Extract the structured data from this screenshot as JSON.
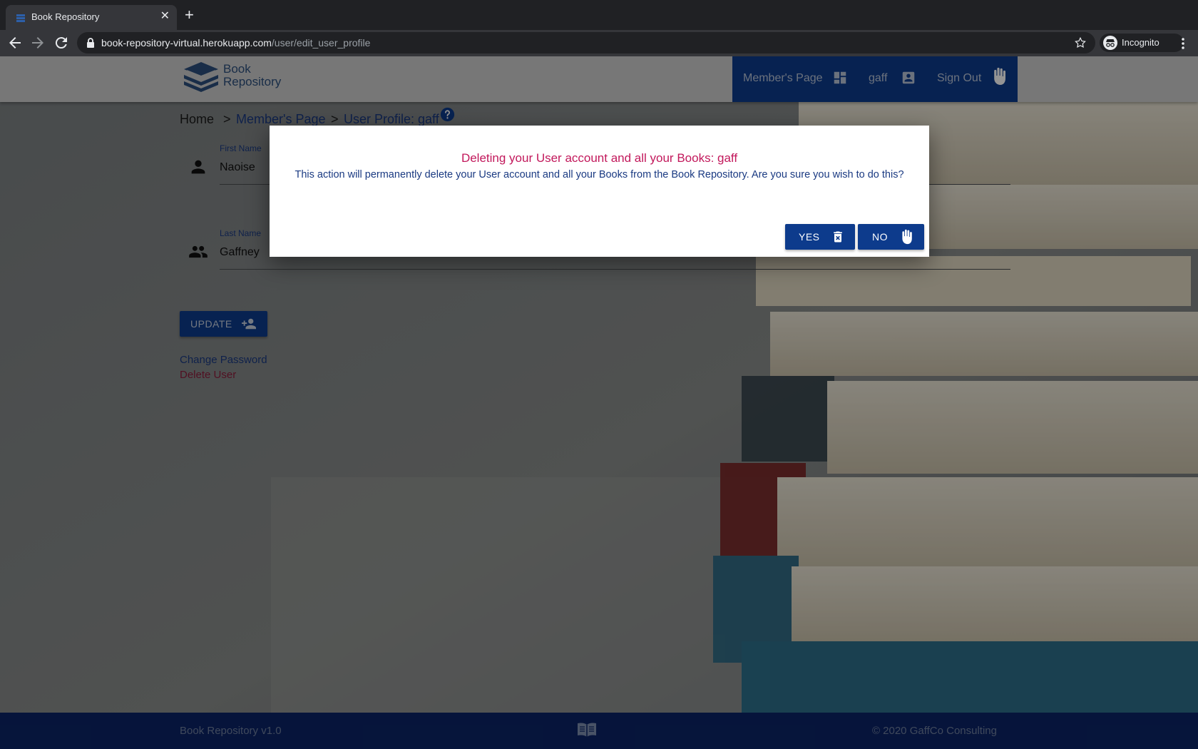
{
  "browser": {
    "tab_title": "Book Repository",
    "tab_close": "✕",
    "new_tab": "+",
    "url_host": "book-repository-virtual.herokuapp.com",
    "url_path": "/user/edit_user_profile",
    "profile_label": "Incognito"
  },
  "navbar": {
    "logo_line1": "Book",
    "logo_line2": "Repository",
    "members_page": "Member's Page",
    "username": "gaff",
    "sign_out": "Sign Out"
  },
  "breadcrumb": {
    "home": "Home",
    "separator": ">",
    "members_page": "Member's Page",
    "current": "User Profile: gaff"
  },
  "form": {
    "first_name_label": "First Name",
    "first_name_value": "Naoise",
    "last_name_label": "Last Name",
    "last_name_value": "Gaffney",
    "update_label": "UPDATE"
  },
  "links": {
    "change_password": "Change Password",
    "delete_user": "Delete User"
  },
  "modal": {
    "title": "Deleting your User account and all your Books: gaff",
    "body": "This action will permanently delete your User account and all your Books from the Book Repository. Are you sure you wish to do this?",
    "yes_label": "YES",
    "no_label": "NO"
  },
  "footer": {
    "version": "Book Repository v1.0",
    "copyright": "© 2020 GaffCo Consulting"
  },
  "colors": {
    "primary": "#0d3b8c",
    "accent": "#c2185b",
    "footer": "#0b2466"
  }
}
